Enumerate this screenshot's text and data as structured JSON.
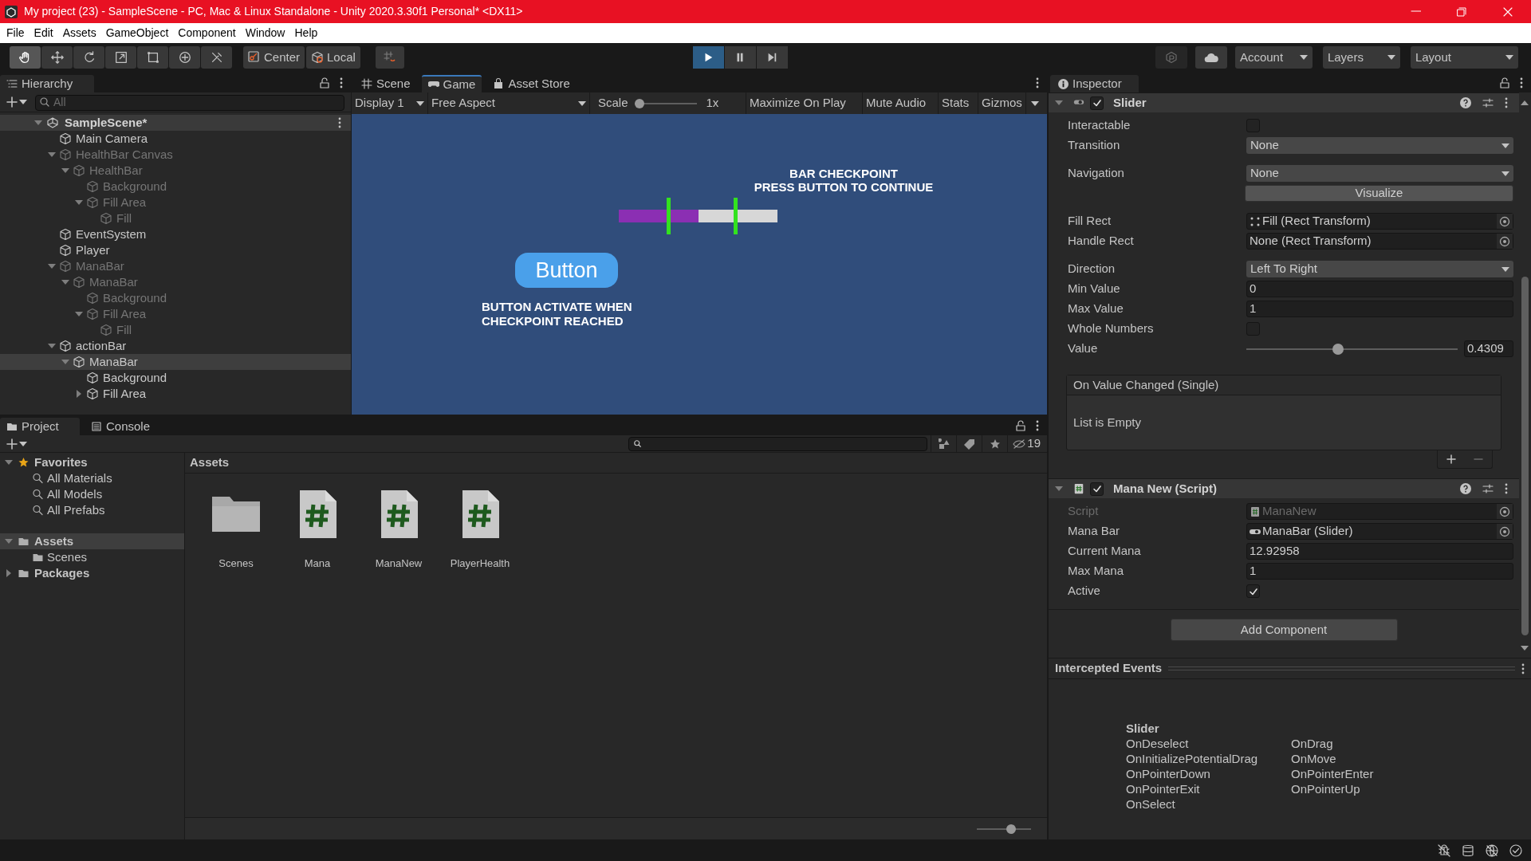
{
  "title_bar": {
    "title": "My project (23) - SampleScene - PC, Mac & Linux Standalone - Unity 2020.3.30f1 Personal* <DX11>"
  },
  "menu": [
    "File",
    "Edit",
    "Assets",
    "GameObject",
    "Component",
    "Window",
    "Help"
  ],
  "toolbar": {
    "tools": [
      {
        "kind": "hand",
        "selected": true
      },
      {
        "kind": "move",
        "selected": false
      },
      {
        "kind": "rotate",
        "selected": false
      },
      {
        "kind": "scale",
        "selected": false
      },
      {
        "kind": "rect",
        "selected": false
      },
      {
        "kind": "transform",
        "selected": false
      },
      {
        "kind": "custom",
        "selected": false
      }
    ],
    "pivot": "Center",
    "space": "Local",
    "playback": [
      {
        "kind": "play",
        "selected": true
      },
      {
        "kind": "pause",
        "selected": false
      },
      {
        "kind": "step",
        "selected": false
      }
    ],
    "dropdowns": [
      "Account",
      "Layers",
      "Layout"
    ]
  },
  "hierarchy": {
    "title": "Hierarchy",
    "search_placeholder": "All",
    "scene": {
      "name": "SampleScene*",
      "expanded": true
    },
    "items": [
      {
        "name": "Main Camera",
        "disabled": false,
        "selected": false
      },
      {
        "name": "HealthBar Canvas",
        "disabled": true,
        "selected": false,
        "expanded": true,
        "children": [
          {
            "name": "HealthBar",
            "disabled": true,
            "selected": false,
            "expanded": true,
            "children": [
              {
                "name": "Background",
                "disabled": true,
                "selected": false
              },
              {
                "name": "Fill Area",
                "disabled": true,
                "selected": false,
                "expanded": true,
                "children": [
                  {
                    "name": "Fill",
                    "disabled": true,
                    "selected": false
                  }
                ]
              }
            ]
          }
        ]
      },
      {
        "name": "EventSystem",
        "disabled": false,
        "selected": false
      },
      {
        "name": "Player",
        "disabled": false,
        "selected": false
      },
      {
        "name": "ManaBar",
        "disabled": true,
        "selected": false,
        "expanded": true,
        "children": [
          {
            "name": "ManaBar",
            "disabled": true,
            "selected": false,
            "expanded": true,
            "children": [
              {
                "name": "Background",
                "disabled": true,
                "selected": false
              },
              {
                "name": "Fill Area",
                "disabled": true,
                "selected": false,
                "expanded": true,
                "children": [
                  {
                    "name": "Fill",
                    "disabled": true,
                    "selected": false
                  }
                ]
              }
            ]
          }
        ]
      },
      {
        "name": "actionBar",
        "disabled": false,
        "selected": false,
        "expanded": true,
        "children": [
          {
            "name": "ManaBar",
            "disabled": false,
            "selected": true,
            "expanded": true,
            "children": [
              {
                "name": "Background",
                "disabled": false,
                "selected": false
              },
              {
                "name": "Fill Area",
                "disabled": false,
                "selected": false,
                "expanded": false
              }
            ]
          }
        ]
      }
    ]
  },
  "game_view": {
    "tabs": [
      {
        "label": "Scene",
        "kind": "scene",
        "selected": false
      },
      {
        "label": "Game",
        "kind": "game",
        "selected": true
      },
      {
        "label": "Asset Store",
        "kind": "store",
        "selected": false
      }
    ],
    "display": "Display 1",
    "aspect": "Free Aspect",
    "scale_label": "Scale",
    "scale": {
      "level": 0
    },
    "scale_value": "1x",
    "toggles": [
      "Maximize On Play",
      "Mute Audio",
      "Stats"
    ],
    "gizmos": "Gizmos",
    "scene": {
      "checkpoint_text": [
        "BAR CHECKPOINT",
        "PRESS BUTTON TO CONTINUE"
      ],
      "bar": {
        "level": 0.5
      },
      "button": "Button",
      "hint": [
        "BUTTON ACTIVATE WHEN",
        "CHECKPOINT REACHED"
      ]
    }
  },
  "inspector": {
    "title": "Inspector",
    "components": [
      {
        "name": "Slider",
        "kind": "slider",
        "enabled": true,
        "expanded": true,
        "groups": [
          [
            {
              "kind": "checkbox",
              "label": "Interactable",
              "checked": false
            },
            {
              "kind": "dropdown",
              "label": "Transition",
              "value": "None"
            }
          ],
          [
            {
              "kind": "dropdown",
              "label": "Navigation",
              "value": "None"
            },
            {
              "kind": "button",
              "value": "Visualize"
            }
          ],
          [
            {
              "kind": "object",
              "label": "Fill Rect",
              "value": "Fill (Rect Transform)"
            },
            {
              "kind": "object",
              "label": "Handle Rect",
              "value": "None (Rect Transform)"
            }
          ],
          [
            {
              "kind": "dropdown",
              "label": "Direction",
              "value": "Left To Right"
            },
            {
              "kind": "number",
              "label": "Min Value",
              "value": "0"
            },
            {
              "kind": "number",
              "label": "Max Value",
              "value": "1"
            },
            {
              "kind": "checkbox",
              "label": "Whole Numbers",
              "checked": false
            },
            {
              "kind": "slider",
              "label": "Value",
              "level": 0.43,
              "value": "0.4309"
            }
          ]
        ],
        "event": {
          "title": "On Value Changed (Single)",
          "empty_text": "List is Empty"
        }
      },
      {
        "name": "Mana New (Script)",
        "kind": "script",
        "enabled": true,
        "expanded": true,
        "groups": [
          [
            {
              "kind": "object",
              "label": "Script",
              "value": "ManaNew",
              "disabled": true
            },
            {
              "kind": "object",
              "label": "Mana Bar",
              "value": "ManaBar (Slider)",
              "disabled": false
            },
            {
              "kind": "number",
              "label": "Current Mana",
              "value": "12.92958",
              "disabled": false
            },
            {
              "kind": "number",
              "label": "Max Mana",
              "value": "1",
              "disabled": false
            },
            {
              "kind": "checkbox",
              "label": "Active",
              "checked": true,
              "disabled": false
            }
          ]
        ]
      }
    ],
    "add_button": "Add Component",
    "intercepted": {
      "title": "Intercepted Events",
      "heading": "Slider",
      "events": [
        "OnDeselect",
        "OnDrag",
        "OnInitializePotentialDrag",
        "OnMove",
        "OnPointerDown",
        "OnPointerEnter",
        "OnPointerExit",
        "OnPointerUp",
        "OnSelect"
      ]
    }
  },
  "project": {
    "tabs": [
      {
        "label": "Project",
        "kind": "project",
        "selected": true
      },
      {
        "label": "Console",
        "kind": "console",
        "selected": false
      }
    ],
    "hidden_count": "19",
    "tree": [
      {
        "name": "Favorites",
        "kind": "favorites",
        "expanded": true,
        "selected": false,
        "children": [
          {
            "name": "All Materials",
            "kind": "search",
            "selected": false
          },
          {
            "name": "All Models",
            "kind": "search",
            "selected": false
          },
          {
            "name": "All Prefabs",
            "kind": "search",
            "selected": false
          }
        ]
      },
      {
        "name": "Assets",
        "kind": "folder",
        "expanded": true,
        "selected": true,
        "children": [
          {
            "name": "Scenes",
            "kind": "folder",
            "selected": false
          }
        ]
      },
      {
        "name": "Packages",
        "kind": "folder",
        "expanded": false,
        "selected": false
      }
    ],
    "breadcrumb": "Assets",
    "assets": [
      {
        "name": "Scenes",
        "kind": "folder"
      },
      {
        "name": "Mana",
        "kind": "script"
      },
      {
        "name": "ManaNew",
        "kind": "script"
      },
      {
        "name": "PlayerHealth",
        "kind": "script"
      }
    ],
    "zoom": {
      "level": 0.66
    }
  }
}
